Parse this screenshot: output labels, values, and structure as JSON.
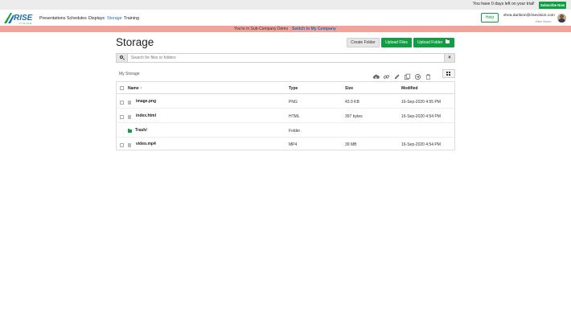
{
  "trial": {
    "text": "You have 0 days left on your trial!",
    "subscribe_label": "Subscribe Now"
  },
  "logo": {
    "text": "RISE",
    "sub": "VISION"
  },
  "nav": {
    "items": [
      {
        "label": "Presentations"
      },
      {
        "label": "Schedules"
      },
      {
        "label": "Displays"
      },
      {
        "label": "Storage",
        "active": true
      },
      {
        "label": "Training"
      }
    ]
  },
  "user": {
    "help_label": "Help",
    "email": "shea.darlison@risevision.com",
    "company": "Rise Vision"
  },
  "subcompany": {
    "text": "You're in Sub-Company Demo",
    "switch_label": "Switch to My Company"
  },
  "page": {
    "title": "Storage"
  },
  "actions": {
    "create_folder": "Create Folder",
    "upload_files": "Upload Files",
    "upload_folder": "Upload Folder"
  },
  "search": {
    "placeholder": "Search for files or folders",
    "value": ""
  },
  "breadcrumb": {
    "label": "My Storage"
  },
  "toolbar_icons": [
    "cloud-download-icon",
    "link-icon",
    "pencil-icon",
    "copy-icon",
    "circle-arrow-icon",
    "trash-icon",
    "grid-view-icon"
  ],
  "table": {
    "columns": [
      "Name ↑",
      "Type",
      "Size",
      "Modified"
    ],
    "rows": [
      {
        "name": "image.png",
        "type": "PNG",
        "size": "43.9 KB",
        "modified": "16-Sep-2020 4:55 PM",
        "kind": "file"
      },
      {
        "name": "index.html",
        "type": "HTML",
        "size": "397 bytes",
        "modified": "16-Sep-2020 4:54 PM",
        "kind": "file"
      },
      {
        "name": "Trash/",
        "type": "Folder",
        "size": "",
        "modified": "",
        "kind": "folder"
      },
      {
        "name": "video.mp4",
        "type": "MP4",
        "size": "39 MB",
        "modified": "16-Sep-2020 4:54 PM",
        "kind": "file"
      }
    ]
  },
  "colors": {
    "brand_green": "#0f9f43",
    "accent_blue": "#1f6fb2",
    "subcompany_bar": "#f0a49b"
  }
}
